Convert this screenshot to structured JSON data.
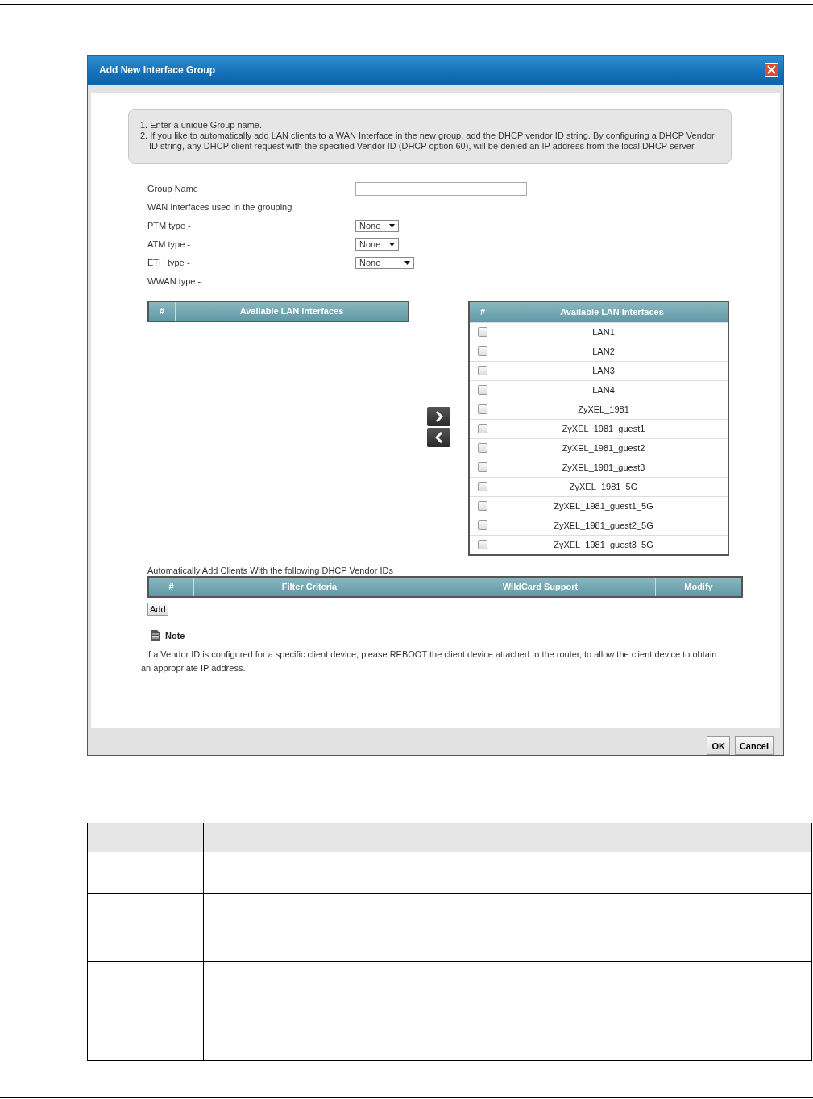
{
  "dialog": {
    "title": "Add New Interface Group",
    "instructions": [
      "1. Enter a unique Group name.",
      "2. If you like to automatically add LAN clients to a WAN Interface in the new group, add the DHCP vendor ID string. By configuring a DHCP Vendor ID string, any DHCP client request with the specified Vendor ID (DHCP option 60), will be denied an IP address from the local DHCP server."
    ],
    "form": [
      {
        "kind": "text",
        "label": "Group Name"
      },
      {
        "kind": "heading",
        "label": "WAN Interfaces used in the grouping"
      },
      {
        "kind": "select",
        "label": "PTM type -",
        "value": "None",
        "wide": false
      },
      {
        "kind": "select",
        "label": "ATM type -",
        "value": "None",
        "wide": false
      },
      {
        "kind": "select",
        "label": "ETH type -",
        "value": "None",
        "wide": true
      },
      {
        "kind": "heading",
        "label": "WWAN type -"
      }
    ],
    "left_table": {
      "columns": [
        "#",
        "Available LAN Interfaces"
      ]
    },
    "right_table": {
      "columns": [
        "#",
        "Available LAN Interfaces"
      ],
      "rows": [
        {
          "name": "LAN1",
          "checked": false
        },
        {
          "name": "LAN2",
          "checked": false
        },
        {
          "name": "LAN3",
          "checked": false
        },
        {
          "name": "LAN4",
          "checked": false
        },
        {
          "name": "ZyXEL_1981",
          "checked": false
        },
        {
          "name": "ZyXEL_1981_guest1",
          "checked": false
        },
        {
          "name": "ZyXEL_1981_guest2",
          "checked": false
        },
        {
          "name": "ZyXEL_1981_guest3",
          "checked": false
        },
        {
          "name": "ZyXEL_1981_5G",
          "checked": false
        },
        {
          "name": "ZyXEL_1981_guest1_5G",
          "checked": false
        },
        {
          "name": "ZyXEL_1981_guest2_5G",
          "checked": false
        },
        {
          "name": "ZyXEL_1981_guest3_5G",
          "checked": false
        }
      ]
    },
    "vendor_label": "Automatically Add Clients With the following DHCP Vendor IDs",
    "vendor_table": {
      "columns": [
        "#",
        "Filter Criteria",
        "WildCard Support",
        "Modify"
      ]
    },
    "add_button": "Add",
    "note": {
      "title": "Note",
      "text": "If a Vendor ID is configured for a specific client device, please REBOOT the client device attached to the router, to allow the client device to obtain an appropriate IP address."
    },
    "buttons": [
      "OK",
      "Cancel"
    ]
  }
}
